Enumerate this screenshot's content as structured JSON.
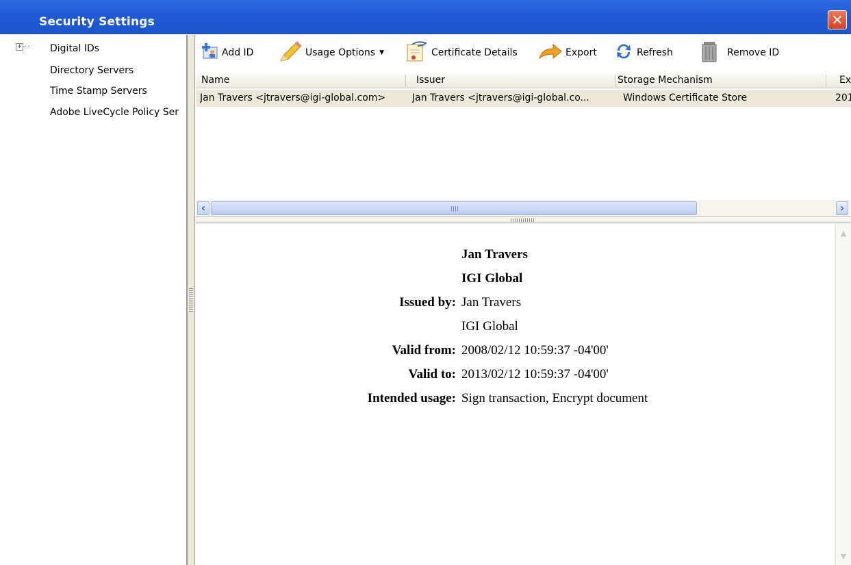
{
  "window": {
    "title": "Security Settings",
    "close_symbol": "✕"
  },
  "sidebar": {
    "expander": "+",
    "items": [
      {
        "label": "Digital IDs"
      },
      {
        "label": "Directory Servers"
      },
      {
        "label": "Time Stamp Servers"
      },
      {
        "label": "Adobe LiveCycle Policy Ser"
      }
    ]
  },
  "toolbar": {
    "add_id": "Add ID",
    "usage_options": "Usage Options",
    "usage_options_arrow": "▼",
    "certificate_details": "Certificate Details",
    "export": "Export",
    "refresh": "Refresh",
    "remove_id": "Remove ID"
  },
  "table": {
    "columns": [
      "Name",
      "Issuer",
      "Storage Mechanism",
      "Ex"
    ],
    "rows": [
      [
        "Jan Travers <jtravers@igi-global.com>",
        "Jan Travers <jtravers@igi-global.co...",
        "Windows Certificate Store",
        "201"
      ]
    ]
  },
  "scrollbar": {
    "left_arrow": "‹",
    "right_arrow": "›"
  },
  "details": {
    "name": "Jan Travers",
    "organization": "IGI Global",
    "issued_by_label": "Issued by:",
    "issued_by_name": "Jan Travers",
    "issued_by_org": "IGI Global",
    "valid_from_label": "Valid from:",
    "valid_from": "2008/02/12 10:59:37 -04'00'",
    "valid_to_label": "Valid to:",
    "valid_to": "2013/02/12 10:59:37 -04'00'",
    "intended_usage_label": "Intended usage:",
    "intended_usage": "Sign transaction, Encrypt document"
  },
  "colors": {
    "titlebar": "#1f5cd6",
    "selected_row": "#ece9d8",
    "close_button": "#d8421e"
  }
}
